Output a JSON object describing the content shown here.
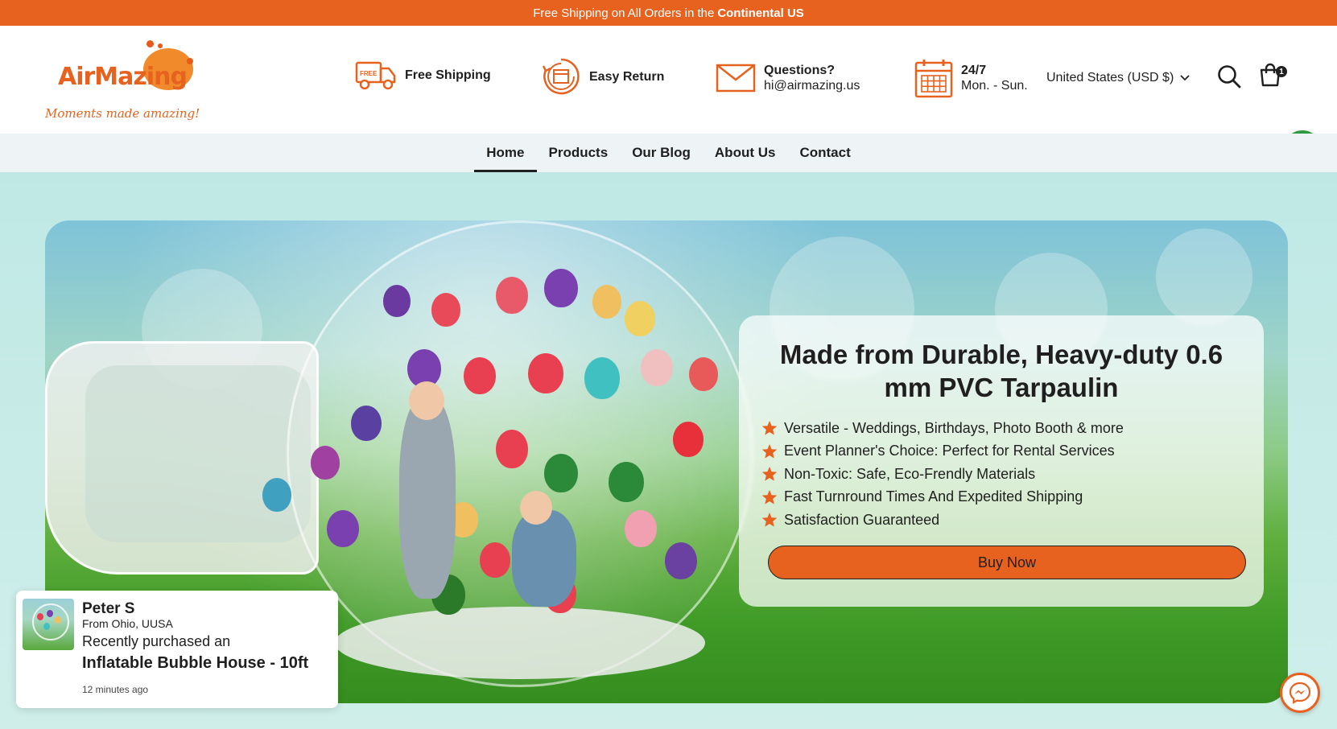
{
  "announcement": {
    "text": "Free Shipping on All Orders in the",
    "bold": "Continental US"
  },
  "brand": {
    "logo_text": "AirMazing",
    "tagline": "Moments made amazing!",
    "accent": "#e8621f"
  },
  "features": [
    {
      "icon": "truck-icon",
      "badge": "FREE",
      "title": "Free Shipping",
      "subtitle": ""
    },
    {
      "icon": "return-box-icon",
      "title": "Easy Return",
      "subtitle": ""
    },
    {
      "icon": "envelope-icon",
      "title": "Questions?",
      "subtitle": "hi@airmazing.us"
    },
    {
      "icon": "calendar-icon",
      "title": "24/7",
      "subtitle": "Mon. - Sun."
    }
  ],
  "header": {
    "currency": "United States (USD $)",
    "cart_count": "1"
  },
  "nav": {
    "items": [
      "Home",
      "Products",
      "Our Blog",
      "About Us",
      "Contact"
    ],
    "active": "Home"
  },
  "hero": {
    "title": "Made from Durable, Heavy-duty 0.6 mm PVC Tarpaulin",
    "bullets": [
      "Versatile - Weddings, Birthdays, Photo Booth & more",
      "Event Planner's Choice: Perfect for Rental Services",
      "Non-Toxic: Safe, Eco-Frendly Materials",
      "Fast Turnround Times And Expedited Shipping",
      "Satisfaction Guaranteed"
    ],
    "cta": "Buy Now"
  },
  "purchase_popup": {
    "name": "Peter S",
    "from": "From Ohio, UUSA",
    "recent": "Recently purchased an",
    "product": "Inflatable Bubble House - 10ft",
    "time": "12 minutes ago"
  }
}
